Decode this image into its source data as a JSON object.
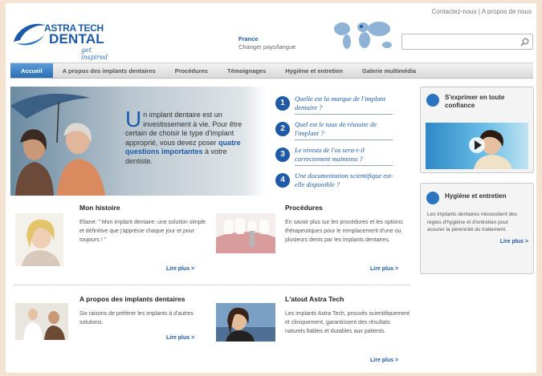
{
  "toplinks": {
    "contact": "Contactez-nous",
    "sep": " | ",
    "about": "A propos de nous"
  },
  "logo": {
    "line1": "ASTRA TECH",
    "line2": "DENTAL",
    "tagline": "get inspired"
  },
  "country": {
    "name": "France",
    "change": "Changer pays/langue"
  },
  "search": {
    "placeholder": "",
    "value": ""
  },
  "nav": [
    "Accueil",
    "A propos des implants dentaires",
    "Procédures",
    "Témoignages",
    "Hygiène et entretien",
    "Galerie multimédia"
  ],
  "hero": {
    "dropcap": "U",
    "text_pre": "n implant dentaire est un investissement à vie. Pour être certain de choisir le type d'implant approprié, vous devez poser ",
    "text_hl": "quatre questions importantes",
    "text_post": " à votre dentiste.",
    "questions": [
      {
        "num": "1",
        "text": "Quelle est la marque de l'implant dentaire ?"
      },
      {
        "num": "2",
        "text": "Quel est le taux de réussite de l'implant ?"
      },
      {
        "num": "3",
        "text": "Le niveau de l'os sera-t-il correctement maintenu ?"
      },
      {
        "num": "4",
        "text": "Une documentation scientifique est-elle disponible ?"
      }
    ]
  },
  "blocks": {
    "histoire": {
      "title": "Mon histoire",
      "text": "Eliane: \" Mon implant dentaire: une solution simple et définitive que j'apprécie chaque jour et pour toujours ! \"",
      "more": "Lire plus >"
    },
    "procedures": {
      "title": "Procédures",
      "text": "En savoir plus sur les procédures et les options thérapeutiques pour le remplacement d'une ou plusieurs dents par les implants dentaires.",
      "more": "Lire plus >"
    },
    "apropos": {
      "title": "A propos des implants dentaires",
      "text": "Six raisons de préférer les implants à d'autres solutions.",
      "more": "Lire plus >"
    },
    "atout": {
      "title": "L'atout Astra Tech",
      "text": "Les implants Astra Tech, prouvés scientifiquement et cliniquement, garantissent des résultats naturels fiables et durables aux patients.",
      "more": "Lire plus >"
    }
  },
  "sidebar": {
    "confiance": {
      "title": "S'exprimer en toute confiance"
    },
    "hygiene": {
      "title": "Hygiène et entretien",
      "text": "Les implants dentaires nécessitent des règles d'hygiène et d'entretien pour assurer la pérennité du traitement.",
      "more": "Lire plus >"
    }
  },
  "colors": {
    "brand": "#1e5aa8",
    "nav_active": "#2b6fb3"
  }
}
